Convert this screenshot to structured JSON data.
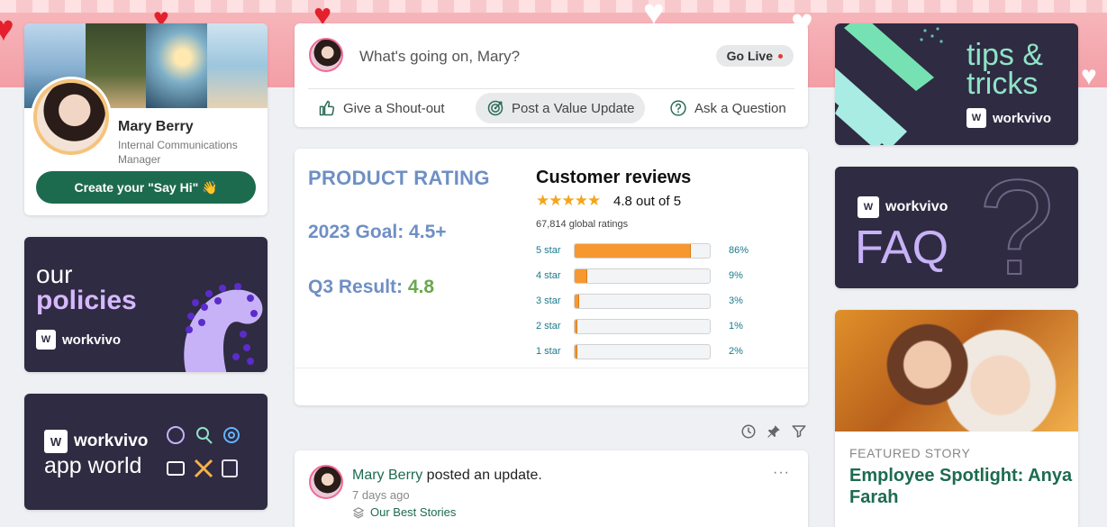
{
  "profile": {
    "name": "Mary Berry",
    "role": "Internal Communications Manager",
    "say_hi_button": "Create your \"Say Hi\" 👋"
  },
  "promo_policies": {
    "line1": "our",
    "line2": "policies",
    "brand": "workvivo"
  },
  "promo_appworld": {
    "brand": "workvivo",
    "line": "app world"
  },
  "composer": {
    "placeholder": "What's going on, Mary?",
    "go_live": "Go Live",
    "actions": [
      {
        "label": "Give a Shout-out",
        "icon": "thumbs-up-icon"
      },
      {
        "label": "Post a Value Update",
        "icon": "target-icon"
      },
      {
        "label": "Ask a Question",
        "icon": "question-circle-icon"
      }
    ]
  },
  "rating_card": {
    "title": "PRODUCT RATING",
    "goal": "2023 Goal: 4.5+",
    "result_label": "Q3 Result: ",
    "result_value": "4.8",
    "reviews_title": "Customer reviews",
    "stars": "★★★★★",
    "out_of": "4.8 out of 5",
    "global_ratings": "67,814 global ratings",
    "rows": [
      {
        "label": "5 star",
        "percent": 86,
        "text": "86%"
      },
      {
        "label": "4 star",
        "percent": 9,
        "text": "9%"
      },
      {
        "label": "3 star",
        "percent": 3,
        "text": "3%"
      },
      {
        "label": "2 star",
        "percent": 1,
        "text": "1%"
      },
      {
        "label": "1 star",
        "percent": 2,
        "text": "2%"
      }
    ]
  },
  "feed_tools": [
    "clock-icon",
    "pin-icon",
    "filter-icon"
  ],
  "post": {
    "author": "Mary Berry",
    "action": " posted an update.",
    "time": "7 days ago",
    "space": "Our Best Stories",
    "more": "···"
  },
  "promo_tips": {
    "line1": "tips &",
    "line2": "tricks",
    "brand": "workvivo"
  },
  "promo_faq": {
    "brand": "workvivo",
    "text": "FAQ",
    "glyph": "?"
  },
  "featured": {
    "label": "FEATURED STORY",
    "title": "Employee Spotlight: Anya Farah"
  },
  "colors": {
    "brand_green": "#1d6b4f",
    "promo_dark": "#2f2b42",
    "rating_blue": "#6f8fc4",
    "bar_orange": "#f6982f"
  }
}
